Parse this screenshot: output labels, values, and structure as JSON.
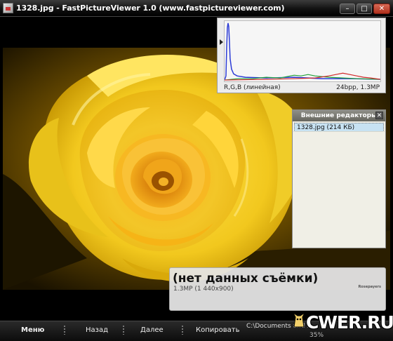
{
  "window": {
    "title": "1328.jpg - FastPictureViewer 1.0 (www.fastpictureviewer.com)",
    "minimize_glyph": "–",
    "maximize_glyph": "□",
    "close_glyph": "✕"
  },
  "histogram": {
    "caption_left": "R,G,B (линейная)",
    "caption_right": "24bpp, 1.3MP",
    "colors": {
      "blue": "#2b3bd6",
      "green": "#22a03a",
      "red": "#d02828"
    }
  },
  "editors_panel": {
    "title": "Внешние редакторы",
    "close_glyph": "✕",
    "items": [
      "1328.jpg (214 КБ)"
    ]
  },
  "info_overlay": {
    "title": "(нет данных съёмки)",
    "subtitle": "1.3MP (1 440x900)",
    "logo_text": "Rosepayers"
  },
  "toolbar": {
    "menu_label": "Меню",
    "back_label": "Назад",
    "next_label": "Далее",
    "copy_label": "Копировать",
    "path_text": "C:\\Documents and S",
    "zoom_text": "35%"
  },
  "watermark": {
    "text": "CWER.RU"
  }
}
